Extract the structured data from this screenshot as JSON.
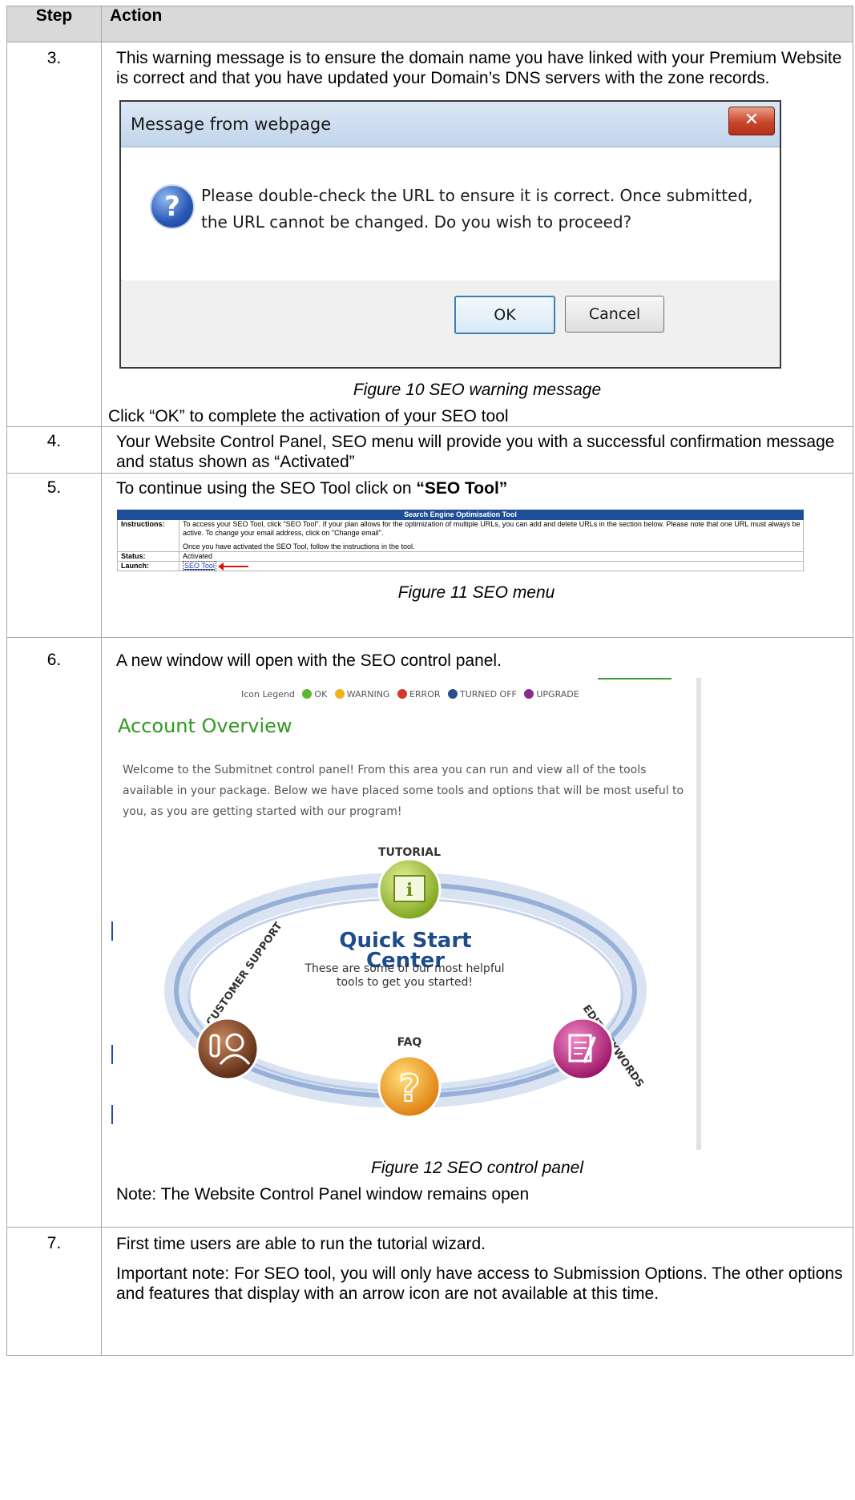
{
  "header": {
    "step": "Step",
    "action": "Action"
  },
  "step3": {
    "number": "3.",
    "intro": "This warning message is to ensure the domain name you have linked with your Premium Website is correct and that you have updated your Domain’s DNS servers with the zone records.",
    "dialog": {
      "title": "Message from webpage",
      "close_glyph": "✕",
      "message": "Please double-check the URL to ensure it is correct. Once submitted, the URL cannot be changed. Do you wish to proceed?",
      "ok": "OK",
      "cancel": "Cancel",
      "icon": "question-icon"
    },
    "caption": "Figure 10 SEO warning message",
    "footer": "Click “OK” to complete the activation of your SEO tool"
  },
  "step4": {
    "number": "4.",
    "text": "Your Website Control Panel, SEO menu will provide you with a successful confirmation message and status shown as “Activated”"
  },
  "step5": {
    "number": "5.",
    "text_prefix": "To continue using the SEO Tool click on ",
    "text_bold": "“SEO Tool”",
    "menu": {
      "header": "Search Engine Optimisation Tool",
      "instructions_label": "Instructions:",
      "instructions_text": "To access your SEO Tool, click \"SEO Tool\". If your plan allows for the optimization of multiple URLs, you can add and delete URLs in the section below. Please note that one URL must always be active. To change your email address, click on \"Change email\".",
      "instructions_text2": "Once you have activated the SEO Tool, follow the instructions in the tool.",
      "status_label": "Status:",
      "status_value": "Activated",
      "launch_label": "Launch:",
      "launch_link": "SEO Tool"
    },
    "caption": "Figure 11 SEO menu"
  },
  "step6": {
    "number": "6.",
    "text": "A new window will open with the SEO control panel.",
    "panel": {
      "legend_label": "Icon Legend",
      "legend": [
        {
          "label": "OK",
          "color": "#5cb531"
        },
        {
          "label": "WARNING",
          "color": "#f2b21d"
        },
        {
          "label": "ERROR",
          "color": "#d8352b"
        },
        {
          "label": "TURNED OFF",
          "color": "#2b4f8c"
        },
        {
          "label": "UPGRADE",
          "color": "#8b2a8c"
        }
      ],
      "title": "Account Overview",
      "welcome": "Welcome to the Submitnet control panel! From this area you can run and view all of the tools available in your package. Below we have placed some tools and options that will be most useful to you, as you are getting started with our program!",
      "quick_start_title": "Quick Start Center",
      "quick_start_sub": "These are some of our most helpful tools to get you started!",
      "items": {
        "tutorial": "TUTORIAL",
        "customer_support": "CUSTOMER SUPPORT",
        "edit_keywords": "EDIT KEYWORDS",
        "faq": "FAQ"
      }
    },
    "caption": "Figure 12 SEO control panel",
    "note": "Note: The Website Control Panel window remains open"
  },
  "step7": {
    "number": "7.",
    "text": "First time users are able to run the tutorial wizard.",
    "important": "Important note: For SEO tool, you will only have access to Submission Options. The other options and features that display with an arrow icon are not available at this time."
  }
}
